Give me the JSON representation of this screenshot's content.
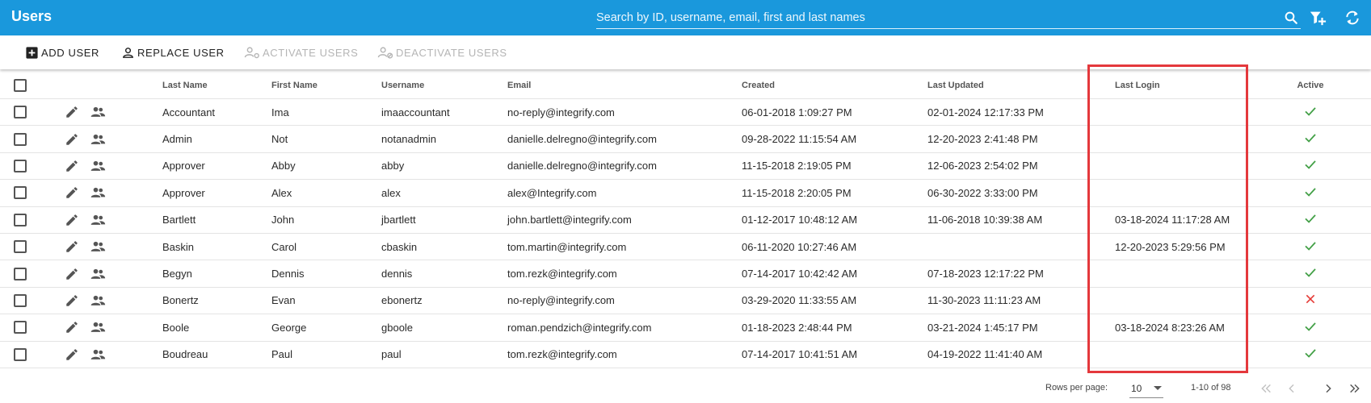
{
  "app": {
    "title": "Users"
  },
  "search": {
    "placeholder": "Search by ID, username, email, first and last names"
  },
  "header_icons": [
    "search-icon",
    "filter-add-icon",
    "refresh-icon"
  ],
  "toolbar": {
    "add_user": "Add User",
    "replace_user": "Replace User",
    "activate_users": "Activate Users",
    "deactivate_users": "Deactivate Users"
  },
  "table": {
    "columns": {
      "last_name": "Last Name",
      "first_name": "First Name",
      "username": "Username",
      "email": "Email",
      "created": "Created",
      "last_updated": "Last Updated",
      "last_login": "Last Login",
      "active": "Active"
    },
    "rows": [
      {
        "last_name": "Accountant",
        "first_name": "Ima",
        "username": "imaaccountant",
        "email": "no-reply@integrify.com",
        "created": "06-01-2018 1:09:27 PM",
        "last_updated": "02-01-2024 12:17:33 PM",
        "last_login": "",
        "active": true
      },
      {
        "last_name": "Admin",
        "first_name": "Not",
        "username": "notanadmin",
        "email": "danielle.delregno@integrify.com",
        "created": "09-28-2022 11:15:54 AM",
        "last_updated": "12-20-2023 2:41:48 PM",
        "last_login": "",
        "active": true
      },
      {
        "last_name": "Approver",
        "first_name": "Abby",
        "username": "abby",
        "email": "danielle.delregno@integrify.com",
        "created": "11-15-2018 2:19:05 PM",
        "last_updated": "12-06-2023 2:54:02 PM",
        "last_login": "",
        "active": true
      },
      {
        "last_name": "Approver",
        "first_name": "Alex",
        "username": "alex",
        "email": "alex@Integrify.com",
        "created": "11-15-2018 2:20:05 PM",
        "last_updated": "06-30-2022 3:33:00 PM",
        "last_login": "",
        "active": true
      },
      {
        "last_name": "Bartlett",
        "first_name": "John",
        "username": "jbartlett",
        "email": "john.bartlett@integrify.com",
        "created": "01-12-2017 10:48:12 AM",
        "last_updated": "11-06-2018 10:39:38 AM",
        "last_login": "03-18-2024 11:17:28 AM",
        "active": true
      },
      {
        "last_name": "Baskin",
        "first_name": "Carol",
        "username": "cbaskin",
        "email": "tom.martin@integrify.com",
        "created": "06-11-2020 10:27:46 AM",
        "last_updated": "",
        "last_login": "12-20-2023 5:29:56 PM",
        "active": true
      },
      {
        "last_name": "Begyn",
        "first_name": "Dennis",
        "username": "dennis",
        "email": "tom.rezk@integrify.com",
        "created": "07-14-2017 10:42:42 AM",
        "last_updated": "07-18-2023 12:17:22 PM",
        "last_login": "",
        "active": true
      },
      {
        "last_name": "Bonertz",
        "first_name": "Evan",
        "username": "ebonertz",
        "email": "no-reply@integrify.com",
        "created": "03-29-2020 11:33:55 AM",
        "last_updated": "11-30-2023 11:11:23 AM",
        "last_login": "",
        "active": false
      },
      {
        "last_name": "Boole",
        "first_name": "George",
        "username": "gboole",
        "email": "roman.pendzich@integrify.com",
        "created": "01-18-2023 2:48:44 PM",
        "last_updated": "03-21-2024 1:45:17 PM",
        "last_login": "03-18-2024 8:23:26 AM",
        "active": true
      },
      {
        "last_name": "Boudreau",
        "first_name": "Paul",
        "username": "paul",
        "email": "tom.rezk@integrify.com",
        "created": "07-14-2017 10:41:51 AM",
        "last_updated": "04-19-2022 11:41:40 AM",
        "last_login": "",
        "active": true
      }
    ]
  },
  "pagination": {
    "rows_per_page_label": "Rows per page:",
    "rows_per_page": "10",
    "range": "1-10 of 98"
  },
  "colors": {
    "appbar": "#1a98dc",
    "active_check": "#43a047",
    "inactive_x": "#e53935",
    "highlight": "#e4383c"
  }
}
